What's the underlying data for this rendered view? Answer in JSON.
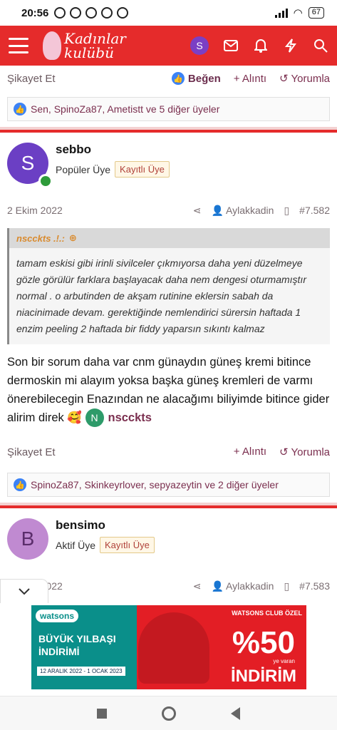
{
  "status": {
    "time": "20:56",
    "battery": "67"
  },
  "appbar": {
    "logo_line1": "Kadınlar",
    "logo_line2": "kulübü",
    "user_initial": "S"
  },
  "top_actions": {
    "report": "Şikayet Et",
    "like": "Beğen",
    "quote": "+ Alıntı",
    "reply": "Yorumla"
  },
  "likes1": "Sen, SpinoZa87, Ametistt ve 5 diğer üyeler",
  "post1": {
    "initial": "S",
    "username": "sebbo",
    "role": "Popüler Üye",
    "tag": "Kayıtlı Üye",
    "date": "2 Ekim 2022",
    "author": "Aylakkadin",
    "number": "#7.582",
    "quote_author": "nscckts .!.:",
    "quote_text": "tamam eskisi gibi irinli sivilceler çıkmıyorsa daha yeni düzelmeye gözle görülür farklara başlayacak daha nem dengesi oturmamıştır normal . o arbutinden de akşam rutinine eklersin sabah da niacinimade devam. gerektiğinde nemlendirici sürersin haftada 1 enzim peeling 2 haftada bir fiddy yaparsın sıkıntı kalmaz",
    "body": "Son bir sorum daha var cnm günaydın güneş kremi bitince dermoskin mi alayım yoksa başka güneş kremleri de varmı önerebilecegin Enazından ne alacağımı biliyimde bitince gider alirim direk",
    "emoji": "🥰",
    "mention_initial": "N",
    "mention_name": "nscckts",
    "report": "Şikayet Et",
    "quote": "+ Alıntı",
    "reply": "Yorumla",
    "likes": "SpinoZa87, Skinkeyrlover, sepyazeytin ve 2 diğer üyeler"
  },
  "post2": {
    "initial": "B",
    "username": "bensimo",
    "role": "Aktif Üye",
    "tag": "Kayıtlı Üye",
    "date": "2 Ekim 2022",
    "author": "Aylakkadin",
    "number": "#7.583"
  },
  "ad": {
    "brand": "watsons",
    "title": "BÜYÜK YILBAŞI İNDİRİMİ",
    "dates": "12 ARALIK 2022 - 1 OCAK 2023",
    "club": "WATSONS CLUB ÖZEL",
    "percent": "%50",
    "note": "ye varan",
    "discount": "İNDİRİM"
  }
}
